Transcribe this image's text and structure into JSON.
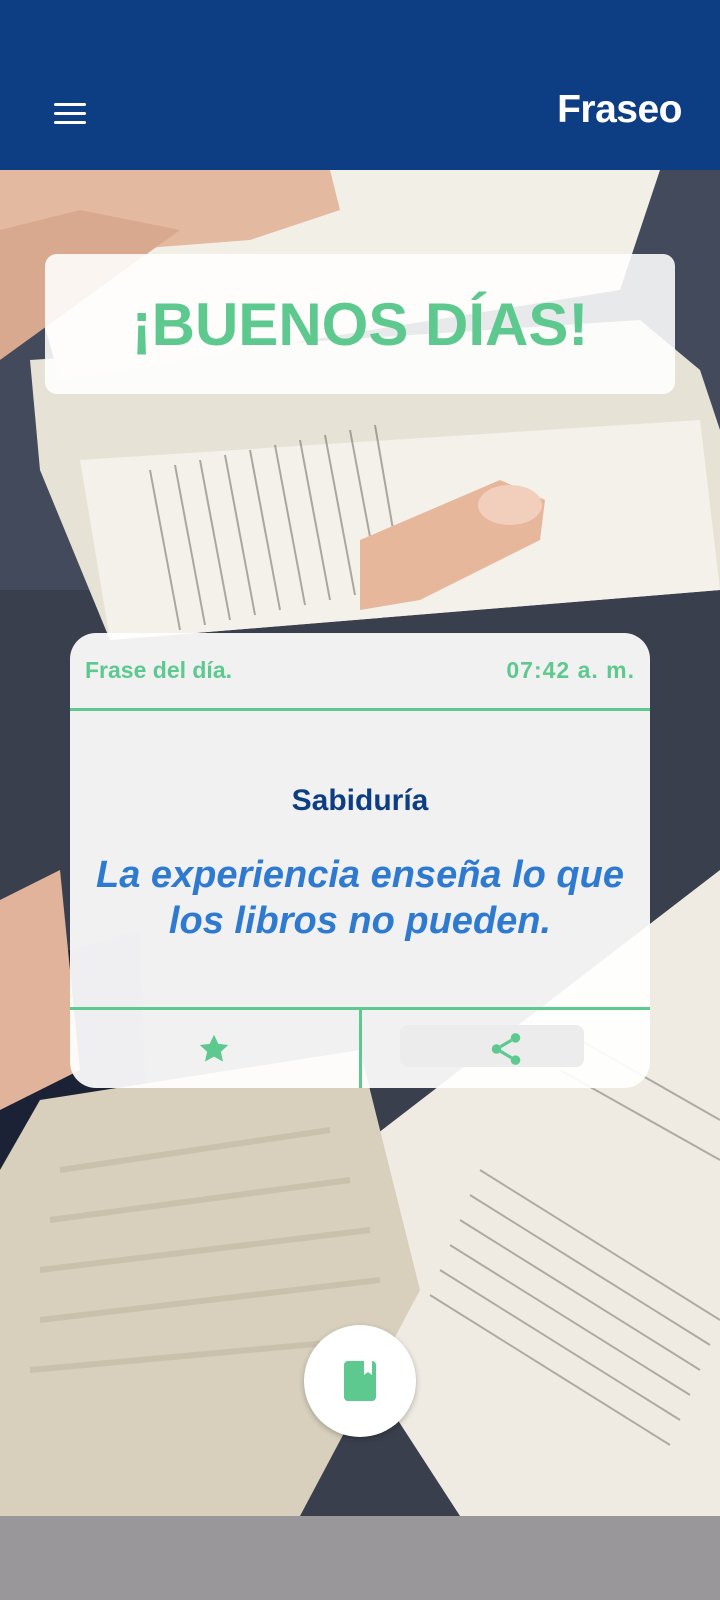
{
  "appbar": {
    "title": "Fraseo",
    "menu_icon": "menu-icon"
  },
  "greeting": {
    "text": "¡BUENOS DÍAS!"
  },
  "card": {
    "label": "Frase del día.",
    "time": "07:42 a. m.",
    "category": "Sabiduría",
    "quote": "La experiencia enseña lo que los libros no pueden.",
    "favorite_icon": "star-icon",
    "share_icon": "share-icon"
  },
  "fab": {
    "icon": "book-icon"
  },
  "colors": {
    "primary": "#0d3d82",
    "accent": "#5ec98f",
    "quote": "#2f7ad1"
  }
}
